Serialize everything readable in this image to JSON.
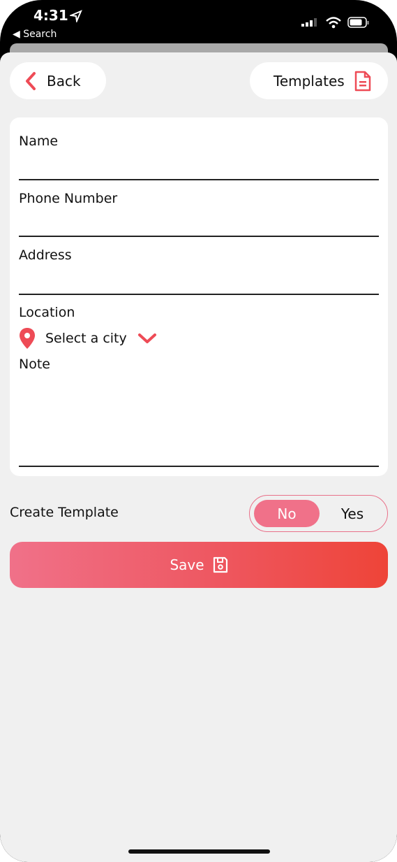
{
  "status_bar": {
    "time": "4:31",
    "back_app": "Search"
  },
  "header": {
    "back_label": "Back",
    "templates_label": "Templates"
  },
  "form": {
    "name_label": "Name",
    "phone_label": "Phone Number",
    "address_label": "Address",
    "location_label": "Location",
    "city_placeholder": "Select a city",
    "note_label": "Note"
  },
  "template_toggle": {
    "label": "Create Template",
    "options": [
      "No",
      "Yes"
    ],
    "selected": "No"
  },
  "save_label": "Save",
  "colors": {
    "accent": "#ee4b56",
    "toggle_active": "#f07189",
    "background": "#f0f0f0"
  }
}
